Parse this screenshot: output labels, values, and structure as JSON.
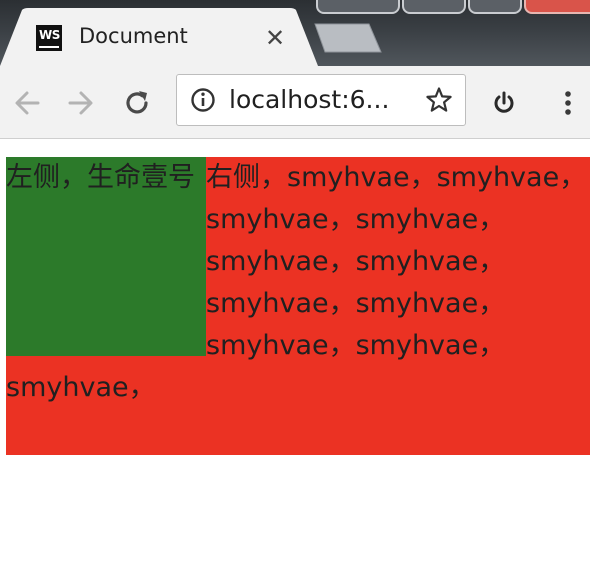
{
  "browser": {
    "tab": {
      "title": "Document",
      "favicon_text": "WS",
      "close_symbol": "✕"
    },
    "toolbar": {
      "back_icon": "arrow-left-icon",
      "forward_icon": "arrow-right-icon",
      "reload_icon": "reload-icon",
      "address": "localhost:6...",
      "info_icon": "info-icon",
      "bookmark_icon": "star-icon",
      "extension_icon": "power-icon",
      "menu_icon": "kebab-menu-icon"
    }
  },
  "page": {
    "left_box_text": "左侧，生命壹号",
    "right_text": "右侧，smyhvae，smyhvae，smyhvae，smyhvae，smyhvae，smyhvae，smyhvae，smyhvae，smyhvae，smyhvae，smyhvae，",
    "colors": {
      "container_bg": "#eb3223",
      "left_box_bg": "#2c7a2a"
    }
  }
}
